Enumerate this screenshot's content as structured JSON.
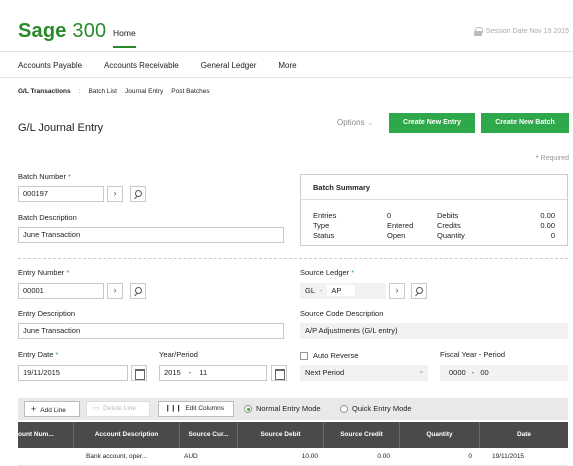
{
  "header": {
    "logo_brand": "Sage",
    "logo_num": "300",
    "home_tab": "Home",
    "user_text": "Session Date  Nov 19 2015"
  },
  "menu": [
    "Accounts Payable",
    "Accounts Receivable",
    "General Ledger",
    "More"
  ],
  "breadcrumb": {
    "first": "G/L Transactions",
    "sep": ":",
    "items": [
      "Batch List",
      "Journal Entry",
      "Post Batches"
    ]
  },
  "page": {
    "title": "G/L Journal Entry",
    "options": "Options",
    "create_entry": "Create New Entry",
    "create_batch": "Create New Batch",
    "required_star": "*",
    "required": "Required"
  },
  "batch": {
    "number_label": "Batch Number",
    "number": "000197",
    "desc_label": "Batch Description",
    "desc": "June Transaction"
  },
  "summary": {
    "title": "Batch Summary",
    "rows": [
      {
        "l1": "Entries",
        "v1": "0",
        "l2": "Debits",
        "v2": "0.00"
      },
      {
        "l1": "Type",
        "v1": "Entered",
        "l2": "Credits",
        "v2": "0.00"
      },
      {
        "l1": "Status",
        "v1": "Open",
        "l2": "Quantity",
        "v2": "0"
      }
    ]
  },
  "entry": {
    "number_label": "Entry Number",
    "number": "00001",
    "desc_label": "Entry Description",
    "desc": "June Transaction",
    "date_label": "Entry Date",
    "date": "19/11/2015",
    "yp_label": "Year/Period",
    "year": "2015",
    "dash": "-",
    "period": "11"
  },
  "source": {
    "ledger_label": "Source Ledger",
    "ledger": "GL",
    "dash": "-",
    "type": "AP",
    "code_desc_label": "Source Code Description",
    "code_desc": "A/P Adjustments (G/L entry)",
    "auto_reverse": "Auto Reverse",
    "next_period": "Next Period",
    "fy_label": "Fiscal Year - Period",
    "fy_year": "0000",
    "fy_dash": "-",
    "fy_period": "00"
  },
  "grid": {
    "add_line": "Add Line",
    "delete_line": "Delete Line",
    "edit_columns": "Edit Columns",
    "normal_mode": "Normal Entry Mode",
    "quick_mode": "Quick Entry Mode",
    "columns": [
      "ount Num...",
      "Account Description",
      "Source Cur...",
      "Source Debit",
      "Source Credit",
      "Quantity",
      "Date"
    ],
    "row": [
      "",
      "Bank account, oper...",
      "AUD",
      "10.00",
      "0.00",
      "0",
      "19/11/2015"
    ]
  },
  "colors": {
    "brand": "#2a8a2a",
    "button": "#2ea84a",
    "header_dark": "#4a4a4a"
  }
}
